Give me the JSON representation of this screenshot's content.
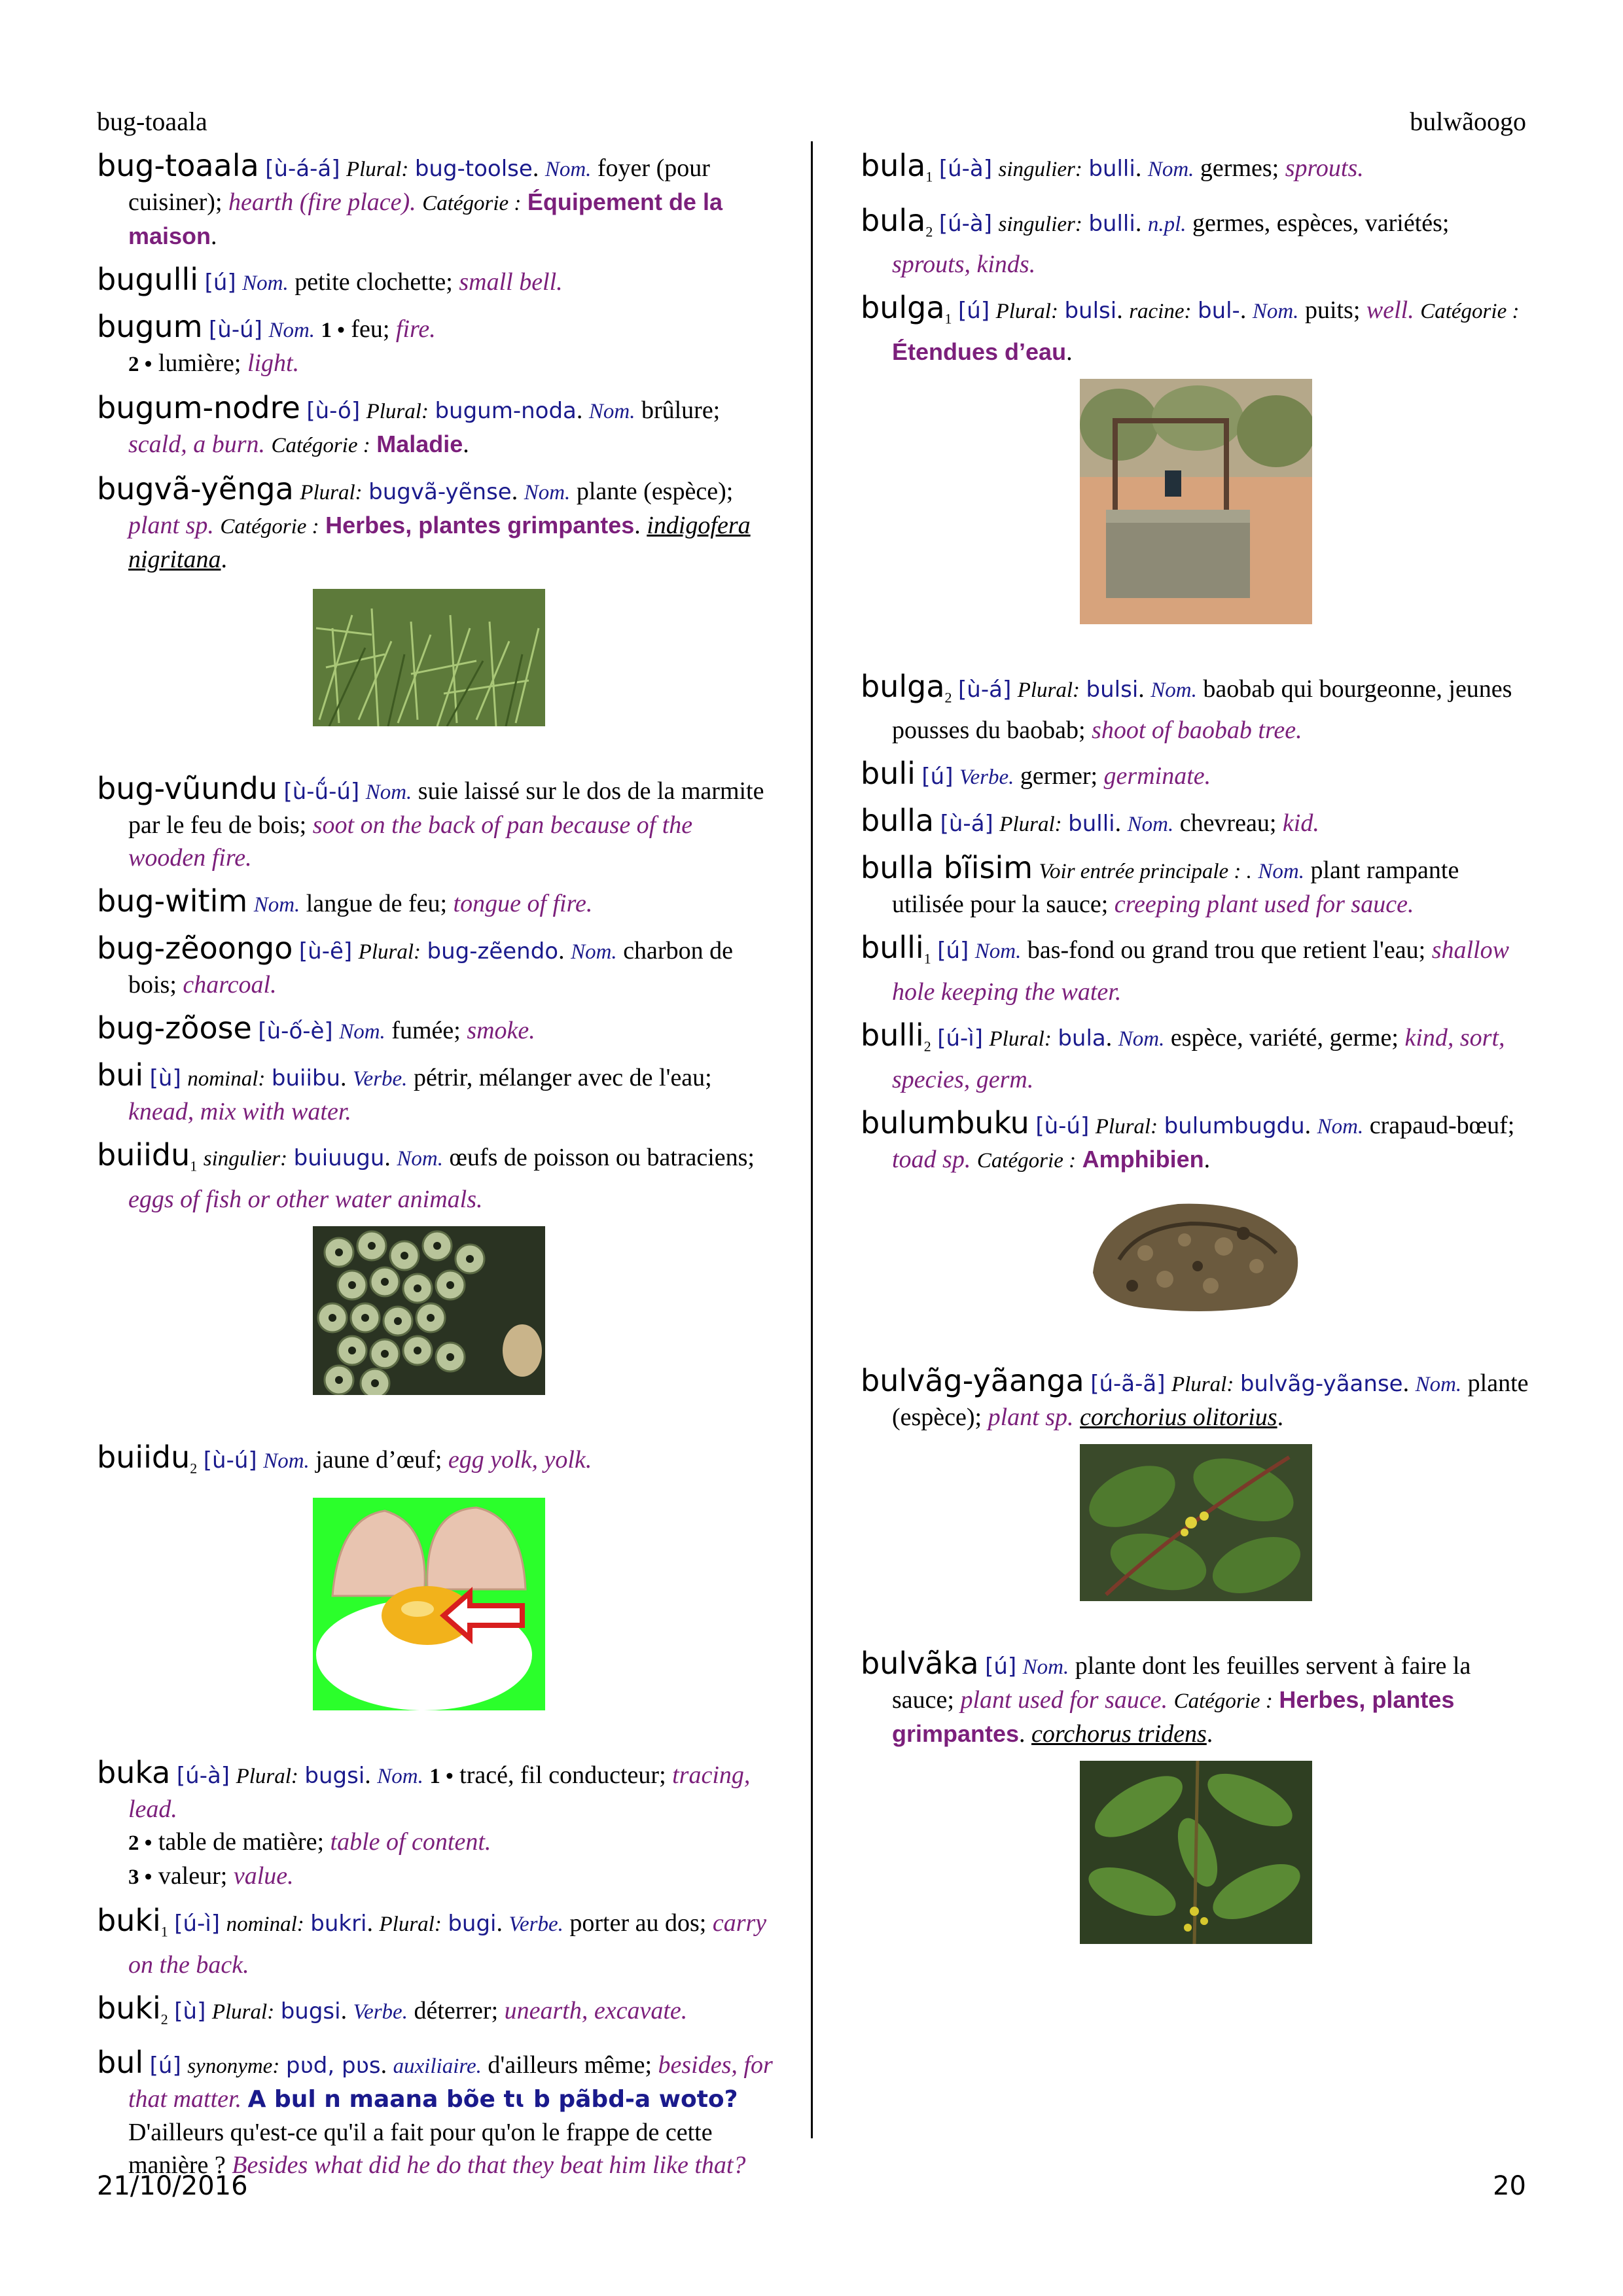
{
  "header": {
    "left": "bug-toaala",
    "right": "bulwãoogo"
  },
  "footer": {
    "date": "21/10/2016",
    "page": "20"
  },
  "labels": {
    "plural": "Plural:",
    "singulier": "singulier:",
    "nominal": "nominal:",
    "racine": "racine:",
    "synonyme": "synonyme:",
    "voir": "Voir entrée principale : .",
    "categorie": "Catégorie :"
  },
  "pos": {
    "nom": "Nom.",
    "verbe": "Verbe.",
    "npl": "n.pl.",
    "aux": "auxiliaire."
  },
  "entries": {
    "bug_toaala": {
      "hw": "bug-toaala",
      "tone": "[ù-á-á]",
      "plural": "bug-toolse",
      "fr": "foyer (pour cuisiner);",
      "en": "hearth (fire place).",
      "cat": "Équipement de la maison"
    },
    "bugulli": {
      "hw": "bugulli",
      "tone": "[ú]",
      "fr": "petite clochette;",
      "en": "small bell."
    },
    "bugum": {
      "hw": "bugum",
      "tone": "[ù-ú]",
      "s1_num": "1 •",
      "s1_fr": "feu;",
      "s1_en": "fire.",
      "s2_num": "2 •",
      "s2_fr": "lumière;",
      "s2_en": "light."
    },
    "bugum_nodre": {
      "hw": "bugum-nodre",
      "tone": "[ù-ó]",
      "plural": "bugum-noda",
      "fr": "brûlure;",
      "en": "scald, a burn.",
      "cat": "Maladie"
    },
    "bugva_yenga": {
      "hw": "bugvã-yẽnga",
      "plural": "bugvã-yẽnse",
      "fr": "plante (espèce);",
      "en": "plant sp.",
      "cat": "Herbes, plantes grimpantes",
      "sci": "indigofera nigritana"
    },
    "bug_vuundu": {
      "hw": "bug-vũundu",
      "tone": "[ù-ṹ-ú]",
      "fr": "suie laissé sur le dos de la marmite par le feu de bois;",
      "en": "soot on the back of pan because of the wooden fire."
    },
    "bug_witim": {
      "hw": "bug-witim",
      "fr": "langue de feu;",
      "en": "tongue of fire."
    },
    "bug_zeoongo": {
      "hw": "bug-zẽoongo",
      "tone": "[ù-ȇ]",
      "plural": "bug-zẽendo",
      "fr": "charbon de bois;",
      "en": "charcoal."
    },
    "bug_zoose": {
      "hw": "bug-zõose",
      "tone": "[ù-ố-è]",
      "fr": "fumée;",
      "en": "smoke."
    },
    "bui": {
      "hw": "bui",
      "tone": "[ù]",
      "nominal": "buiibu",
      "fr": "pétrir, mélanger avec de l'eau;",
      "en": "knead, mix with water."
    },
    "buiidu1": {
      "hw": "buiidu",
      "hom": "1",
      "singulier": "buiuugu",
      "fr": "œufs de poisson ou batraciens;",
      "en": "eggs of fish or other water animals."
    },
    "buiidu2": {
      "hw": "buiidu",
      "hom": "2",
      "tone": "[ù-ú]",
      "fr": "jaune d’œuf;",
      "en": "egg yolk, yolk."
    },
    "buka": {
      "hw": "buka",
      "tone": "[ú-à]",
      "plural": "bugsi",
      "s1_num": "1 •",
      "s1_fr": "tracé, fil conducteur;",
      "s1_en": "tracing, lead.",
      "s2_num": "2 •",
      "s2_fr": "table de matière;",
      "s2_en": "table of content.",
      "s3_num": "3 •",
      "s3_fr": "valeur;",
      "s3_en": "value."
    },
    "buki1": {
      "hw": "buki",
      "hom": "1",
      "tone": "[ú-ì]",
      "nominal": "bukri",
      "plural": "bugi",
      "fr": "porter au dos;",
      "en": "carry on the back."
    },
    "buki2": {
      "hw": "buki",
      "hom": "2",
      "tone": "[ù]",
      "plural": "bugsi",
      "fr": "déterrer;",
      "en": "unearth, excavate."
    },
    "bul": {
      "hw": "bul",
      "tone": "[ú]",
      "synonyme": "pʋd, pʋs",
      "fr": "d'ailleurs même;",
      "en": "besides, for that matter.",
      "ex": "A bul n maana bõe tɩ b pãbd-a woto?",
      "ex_fr": "D'ailleurs qu'est-ce qu'il a fait pour qu'on le frappe de cette manière ?",
      "ex_en": "Besides what did he do that they beat him like that?"
    },
    "bula1": {
      "hw": "bula",
      "hom": "1",
      "tone": "[ú-à]",
      "singulier": "bulli",
      "fr": "germes;",
      "en": "sprouts."
    },
    "bula2": {
      "hw": "bula",
      "hom": "2",
      "tone": "[ú-à]",
      "singulier": "bulli",
      "fr": "germes, espèces, variétés;",
      "en": "sprouts, kinds."
    },
    "bulga1": {
      "hw": "bulga",
      "hom": "1",
      "tone": "[ú]",
      "plural": "bulsi",
      "racine": "bul-",
      "fr": "puits;",
      "en": "well.",
      "cat": "Étendues d’eau"
    },
    "bulga2": {
      "hw": "bulga",
      "hom": "2",
      "tone": "[ù-á]",
      "plural": "bulsi",
      "fr": "baobab qui bourgeonne, jeunes pousses du baobab;",
      "en": "shoot of baobab tree."
    },
    "buli": {
      "hw": "buli",
      "tone": "[ú]",
      "fr": "germer;",
      "en": "germinate."
    },
    "bulla": {
      "hw": "bulla",
      "tone": "[ù-á]",
      "plural": "bulli",
      "fr": "chevreau;",
      "en": "kid."
    },
    "bulla_biisim": {
      "hw": "bulla bĩisim",
      "fr": "plant rampante utilisée pour la sauce;",
      "en": "creeping plant used for sauce."
    },
    "bulli1": {
      "hw": "bulli",
      "hom": "1",
      "tone": "[ú]",
      "fr": "bas-fond ou grand trou que retient l'eau;",
      "en": "shallow hole keeping the water."
    },
    "bulli2": {
      "hw": "bulli",
      "hom": "2",
      "tone": "[ú-ì]",
      "plural": "bula",
      "fr": "espèce, variété, germe;",
      "en": "kind, sort, species, germ."
    },
    "bulumbuku": {
      "hw": "bulumbuku",
      "tone": "[ù-ú]",
      "plural": "bulumbugdu",
      "fr": "crapaud-bœuf;",
      "en": "toad sp.",
      "cat": "Amphibien"
    },
    "bulvag_yaanga": {
      "hw": "bulvãg-yãanga",
      "tone": "[ú-ã-ã]",
      "plural": "bulvãg-yãanse",
      "fr": "plante (espèce);",
      "en": "plant sp.",
      "sci": "corchorius olitorius"
    },
    "bulvaka": {
      "hw": "bulvãka",
      "tone": "[ú]",
      "fr": "plante dont les feuilles servent à faire la sauce;",
      "en": "plant used for sauce.",
      "cat": "Herbes, plantes grimpantes",
      "sci": "corchorus tridens"
    }
  }
}
